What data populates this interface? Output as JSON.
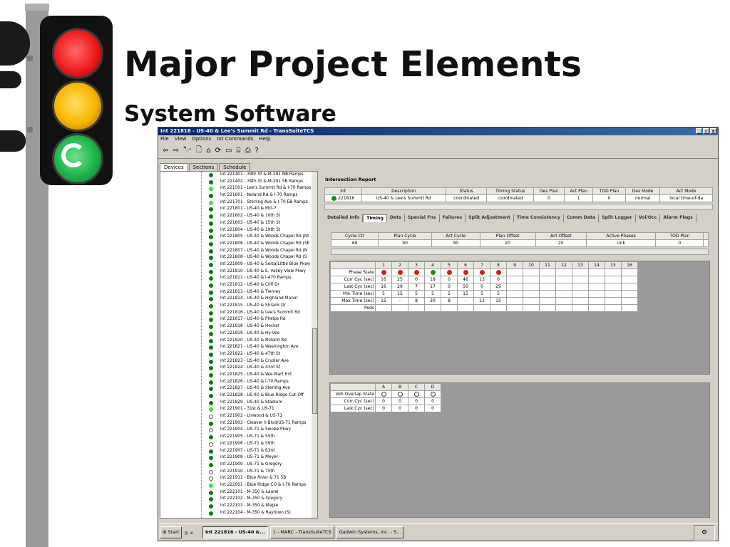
{
  "slide": {
    "title": "Major Project Elements",
    "subtitle": "System Software"
  },
  "window": {
    "title": "Int 221816 - US-40 & Lee's Summit Rd - TransSuiteTCS",
    "menu": [
      "File",
      "View",
      "Options",
      "Int Commands",
      "Help"
    ],
    "toolbar_icons": [
      "back-arrow-icon",
      "forward-arrow-icon",
      "binoculars-icon",
      "document-icon",
      "home-icon",
      "refresh-icon",
      "window-icon",
      "network-icon",
      "print-icon",
      "help-icon"
    ],
    "toolbar_glyphs": [
      "⇦",
      "⇨",
      "🔭",
      "🗋",
      "⌂",
      "⟳",
      "▭",
      "⌸",
      "⎙",
      "?"
    ],
    "left_tabs": [
      "Devices",
      "Sections",
      "Schedule"
    ]
  },
  "tree": [
    {
      "label": "Int 221401 - 39th St & M-291 NB Ramps",
      "status": "dg"
    },
    {
      "label": "Int 221402 - 39th St & M-291 SB Ramps",
      "status": "dg"
    },
    {
      "label": "Int 221501 - Lee's Summit Rd & I-70 Ramps",
      "status": "lg"
    },
    {
      "label": "Int 221601 - Noland Rd & I-70 Ramps",
      "status": "dg"
    },
    {
      "label": "Int 221701 - Sterling Ave & I-70 EB Ramps",
      "status": "lg"
    },
    {
      "label": "Int 221801 - US-40 & MO-7",
      "status": "dg"
    },
    {
      "label": "Int 221802 - US-40 & 10th St",
      "status": "dg"
    },
    {
      "label": "Int 221803 - US-40 & 15th St",
      "status": "dg"
    },
    {
      "label": "Int 221804 - US-40 & 19th St",
      "status": "dg"
    },
    {
      "label": "Int 221805 - US-40 & Woods Chapel Rd (Nt",
      "status": "dg"
    },
    {
      "label": "Int 221806 - US-40 & Woods Chapel Rd (SE",
      "status": "dg"
    },
    {
      "label": "Int 221807 - US-40 & Woods Chapel Rd (N",
      "status": "dg"
    },
    {
      "label": "Int 221808 - US-40 & Woods Chapel Rd (S",
      "status": "dg"
    },
    {
      "label": "Int 221809 - US-40 & Selsa/Little Blue Pkwy",
      "status": "dg"
    },
    {
      "label": "Int 221810 - US-40 & E. Valley View Pkwy",
      "status": "dg"
    },
    {
      "label": "Int 221811 - US-40 & I-470 Ramps",
      "status": "dg"
    },
    {
      "label": "Int 221812 - US-40 & Cliff Dr",
      "status": "dg"
    },
    {
      "label": "Int 221813 - US-40 & Tierney",
      "status": "dg"
    },
    {
      "label": "Int 221814 - US-40 & Highland Manor",
      "status": "dg"
    },
    {
      "label": "Int 221815 - US-40 & Shrank Dr",
      "status": "dg"
    },
    {
      "label": "Int 221816 - US-40 & Lee's Summit Rd",
      "status": "dg"
    },
    {
      "label": "Int 221817 - US-40 & Phelps Rd",
      "status": "dg"
    },
    {
      "label": "Int 221818 - US-40 & Hocker",
      "status": "dg"
    },
    {
      "label": "Int 221819 - US-40 & Hy-Vee",
      "status": "dg"
    },
    {
      "label": "Int 221820 - US-40 & Noland Rd",
      "status": "dg"
    },
    {
      "label": "Int 221821 - US-40 & Washington Ave",
      "status": "dg"
    },
    {
      "label": "Int 221822 - US-40 & 47th St",
      "status": "dg"
    },
    {
      "label": "Int 221823 - US-40 & Crysler Ave",
      "status": "dg"
    },
    {
      "label": "Int 221824 - US-40 & 43rd St",
      "status": "dg"
    },
    {
      "label": "Int 221825 - US-40 & Wal-Mart Ent",
      "status": "dg"
    },
    {
      "label": "Int 221826 - US-40 & I-70 Ramps",
      "status": "dg"
    },
    {
      "label": "Int 221827 - US-40 & Sterling Ave",
      "status": "dg"
    },
    {
      "label": "Int 221828 - US-40 & Blue Ridge Cut-Off",
      "status": "dg"
    },
    {
      "label": "Int 221829 - US-40 & Stadium",
      "status": "dg"
    },
    {
      "label": "Int 221901 - 31st & US-71",
      "status": "lg"
    },
    {
      "label": "Int 221902 - Linwood & US-71",
      "status": "op"
    },
    {
      "label": "Int 221903 - Cleaver II Blvd/US-71 Ramps",
      "status": "dg"
    },
    {
      "label": "Int 221904 - US-71 & Swope Pkwy",
      "status": "op"
    },
    {
      "label": "Int 221905 - US-71 & 55th",
      "status": "dg"
    },
    {
      "label": "Int 221906 - US-71 & 59th",
      "status": "op"
    },
    {
      "label": "Int 221907 - US-71 & 63rd",
      "status": "dg"
    },
    {
      "label": "Int 221908 - US-71 & Meyer",
      "status": "dg"
    },
    {
      "label": "Int 221909 - US-71 & Gregory",
      "status": "dg"
    },
    {
      "label": "Int 221910 - US-71 & 75th",
      "status": "op"
    },
    {
      "label": "Int 221911 - Blue River & 71 SB",
      "status": "op"
    },
    {
      "label": "Int 222001 - Blue Ridge CO & I-70 Ramps",
      "status": "lg"
    },
    {
      "label": "Int 222101 - M-350 & Laurel",
      "status": "dg"
    },
    {
      "label": "Int 222102 - M-350 & Gregory",
      "status": "dg"
    },
    {
      "label": "Int 222103 - M-350 & Maple",
      "status": "dg"
    },
    {
      "label": "Int 222104 - M-350 & Raytown (S)",
      "status": "dg"
    }
  ],
  "report": {
    "title": "Intersection Report",
    "headers": [
      "Int",
      "Description",
      "Status",
      "Timing Status",
      "Des Plan",
      "Act Plan",
      "TOD Plan",
      "Des Mode",
      "Act Mode"
    ],
    "row": [
      "221816",
      "US-40 & Lee's Summit Rd",
      "coordinated",
      "coordinated",
      "0",
      "1",
      "0",
      "normal",
      "local time-of-da"
    ]
  },
  "detail_tabs": [
    "Detailed Info",
    "Timing",
    "Dets",
    "Special Fns",
    "Failures",
    "Split Adjustment",
    "Time Consistency",
    "Comm Data",
    "Split Logger",
    "Vol/Occ",
    "Alarm Flags"
  ],
  "cycle": {
    "headers": [
      "Cycle Ctr",
      "Plan Cycle",
      "Act Cycle",
      "Plan Offset",
      "Act Offset",
      "Active Phases",
      "TOD Plan"
    ],
    "row": [
      "69",
      "90",
      "90",
      "20",
      "20",
      "Unk",
      "0"
    ]
  },
  "phases": {
    "numbers": [
      "1",
      "2",
      "3",
      "4",
      "5",
      "6",
      "7",
      "8",
      "9",
      "10",
      "11",
      "12",
      "13",
      "14",
      "15",
      "16"
    ],
    "state_label": "Phase State",
    "states": [
      "r",
      "r",
      "r",
      "g",
      "r",
      "r",
      "r",
      "r",
      "",
      "",
      "",
      "",
      "",
      "",
      "",
      ""
    ],
    "rows": [
      {
        "label": "Curr Cyc (sec)",
        "values": [
          "16",
          "25",
          "0",
          "18",
          "0",
          "46",
          "13",
          "0",
          "",
          "",
          "",
          "",
          "",
          "",
          "",
          ""
        ]
      },
      {
        "label": "Last Cyc (sec)",
        "values": [
          "16",
          "29",
          "7",
          "17",
          "0",
          "50",
          "0",
          "29",
          "",
          "",
          "",
          "",
          "",
          "",
          "",
          ""
        ]
      },
      {
        "label": "Min Time (sec)",
        "values": [
          "5",
          "15",
          "5",
          "5",
          "5",
          "15",
          "5",
          "5",
          "",
          "",
          "",
          "",
          "",
          "",
          "",
          ""
        ]
      },
      {
        "label": "Max Time (sec)",
        "values": [
          "15",
          "-",
          "8",
          "20",
          "8",
          "-",
          "13",
          "15",
          "",
          "",
          "",
          "",
          "",
          "",
          "",
          ""
        ]
      },
      {
        "label": "Peds",
        "values": [
          "",
          "",
          "",
          "",
          "",
          "",
          "",
          "",
          "",
          "",
          "",
          "",
          "",
          "",
          "",
          ""
        ]
      }
    ]
  },
  "overlaps": {
    "letters": [
      "A",
      "B",
      "C",
      "D"
    ],
    "state_label": "Veh Overlap State",
    "rows": [
      {
        "label": "Curr Cyc (sec)",
        "values": [
          "0",
          "0",
          "0",
          "0"
        ]
      },
      {
        "label": "Last Cyc (sec)",
        "values": [
          "0",
          "0",
          "0",
          "0"
        ]
      }
    ]
  },
  "taskbar": {
    "start": "Start",
    "items": [
      "Int 221816 - US-40 &...",
      "1 - MARC - TransSuiteTCS",
      "Gadwin Systems, Inc. - 5..."
    ]
  }
}
